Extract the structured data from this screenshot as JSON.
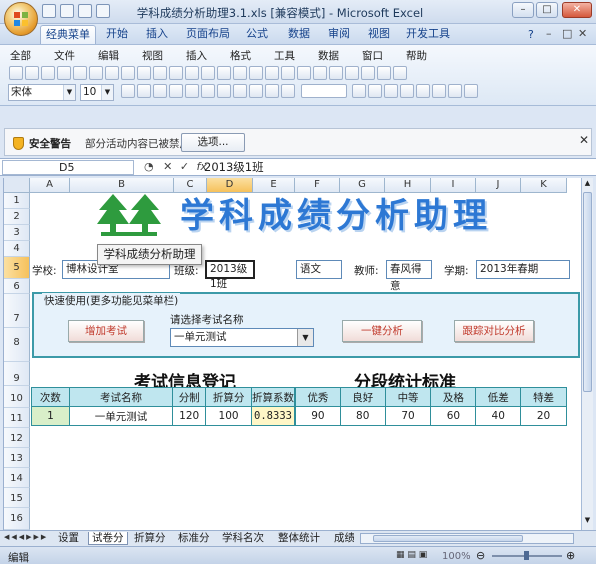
{
  "window": {
    "title": "学科成绩分析助理3.1.xls  [兼容模式] - Microsoft Excel",
    "controls": [
      "–",
      "□",
      "✕"
    ]
  },
  "ribbon_tabs": [
    "经典菜单",
    "开始",
    "插入",
    "页面布局",
    "公式",
    "数据",
    "审阅",
    "视图",
    "开发工具"
  ],
  "classic_menu": [
    "全部",
    "文件",
    "编辑",
    "视图",
    "插入",
    "格式",
    "工具",
    "数据",
    "窗口",
    "帮助"
  ],
  "font": {
    "name": "宋体",
    "size": "10"
  },
  "security": {
    "title": "安全警告",
    "message": "部分活动内容已被禁用。",
    "options_label": "选项..."
  },
  "formula_bar": {
    "name_box": "D5",
    "fx": "fx",
    "value": "2013级1班"
  },
  "columns": [
    "A",
    "B",
    "C",
    "D",
    "E",
    "F",
    "G",
    "H",
    "I",
    "J",
    "K"
  ],
  "rows": [
    "1",
    "2",
    "3",
    "4",
    "5",
    "6",
    "7",
    "8",
    "9",
    "10",
    "11",
    "12",
    "13",
    "14",
    "15",
    "16"
  ],
  "selected_cell": {
    "column": "D",
    "row": "5"
  },
  "banner": {
    "title": "学科成绩分析助理"
  },
  "tooltip": "学科成绩分析助理",
  "info": {
    "school_label": "学校:",
    "school_value": "博林设计室",
    "class_label": "班级:",
    "class_value": "2013级1班",
    "subject_value": "语文",
    "teacher_label": "教师:",
    "teacher_value": "春风得意",
    "term_label": "学期:",
    "term_value": "2013年春期"
  },
  "quick": {
    "legend": "快速使用(更多功能见菜单栏)",
    "add_exam": "增加考试",
    "choose_label": "请选择考试名称",
    "exam_selected": "一单元测试",
    "one_click": "一键分析",
    "track": "跟踪对比分析"
  },
  "exam_section": {
    "heading": "考试信息登记",
    "headers": [
      "次数",
      "考试名称",
      "分制",
      "折算分",
      "折算系数"
    ],
    "row": [
      "1",
      "一单元测试",
      "120",
      "100",
      "0.8333"
    ]
  },
  "stats_section": {
    "heading": "分段统计标准",
    "headers": [
      "优秀",
      "良好",
      "中等",
      "及格",
      "低差",
      "特差"
    ],
    "row": [
      "90",
      "80",
      "70",
      "60",
      "40",
      "20"
    ]
  },
  "sheet_tabs": [
    "设置",
    "试卷分",
    "折算分",
    "标准分",
    "学科名次",
    "整体统计",
    "成绩"
  ],
  "active_sheet": "试卷分",
  "status": {
    "mode": "编辑",
    "zoom": "100%"
  }
}
